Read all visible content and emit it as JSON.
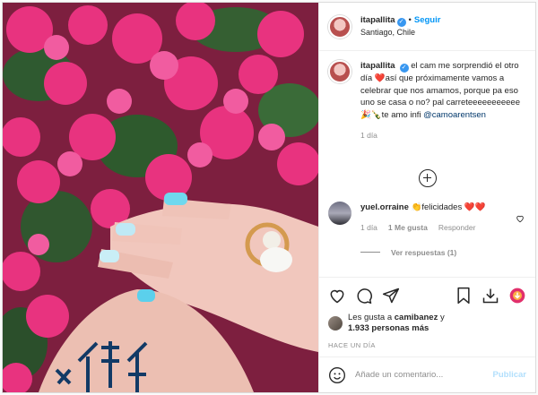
{
  "post": {
    "username": "itapallita",
    "follow_label": "Seguir",
    "location": "Santiago, Chile",
    "caption_text": "el cam me sorprendió el otro día ❤️así que próximamente vamos a celebrar que nos amamos, porque pa eso uno se casa o no? pal carreteeeeeeeeeee🎉🍾te amo infi",
    "caption_mention": "@camoarentsen",
    "caption_age": "1 día",
    "photo_alt": "hands-with-ring-and-bougainvillea"
  },
  "comment": {
    "username": "yuel.orraine",
    "text": "👏felicidades ❤️❤️",
    "age": "1 día",
    "likes": "1 Me gusta",
    "reply_label": "Responder",
    "view_replies": "Ver respuestas (1)"
  },
  "likes": {
    "prefix": "Les gusta a",
    "first_user": "camibanez",
    "connector": "y",
    "others": "1.933 personas más"
  },
  "timestamp": "HACE UN DÍA",
  "add_comment": {
    "placeholder": "Añade un comentario...",
    "publish_label": "Publicar"
  },
  "icons": {
    "like": "heart-icon",
    "comment": "comment-icon",
    "share": "share-icon",
    "save": "bookmark-icon",
    "download": "download-icon",
    "extension": "extension-icon",
    "emoji": "emoji-icon",
    "load_more": "plus-circle-icon"
  },
  "colors": {
    "link_blue": "#0095f6",
    "verified_blue": "#3897f0",
    "mention": "#00376b",
    "muted": "#8e8e8e"
  }
}
